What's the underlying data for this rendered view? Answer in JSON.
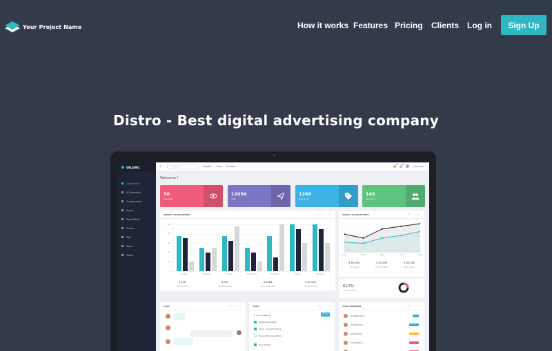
{
  "nav": {
    "brand": "Your Project Name",
    "links": [
      "How it works",
      "Features",
      "Pricing",
      "Clients",
      "Log in"
    ],
    "signup": "Sign Up"
  },
  "hero": {
    "title": "Distro - Best digital advertising company"
  },
  "dashboard": {
    "brand": "VELONIC",
    "sidebar": [
      "Dashboard",
      "UI Elements",
      "Components",
      "Forms",
      "Data Tables",
      "Charts",
      "Mail",
      "Maps",
      "Pages"
    ],
    "topbar": {
      "search": "Search...",
      "links": [
        "English",
        "Files",
        "Finished"
      ],
      "user": "John Doe"
    },
    "welcome": "Welcome !",
    "stats": [
      {
        "value": "50",
        "label": "Total Sales",
        "color": "#ef5b7b",
        "icon": "eye-icon"
      },
      {
        "value": "12056",
        "label": "Visits",
        "color": "#7b76c4",
        "icon": "send-icon"
      },
      {
        "value": "1268",
        "label": "New Orders",
        "color": "#3bb3e6",
        "icon": "tag-icon"
      },
      {
        "value": "145",
        "label": "New Users",
        "color": "#5dc37f",
        "icon": "users-icon"
      }
    ],
    "weekly": {
      "title": "WEEKLY SALES REPORT",
      "summary": [
        {
          "value": "$ 126",
          "label": "Today's Sales"
        },
        {
          "value": "$ 967",
          "label": "This Week Sales"
        },
        {
          "value": "$ 4568",
          "label": "This Month Sales"
        },
        {
          "value": "$ 67,000",
          "label": "This Year Sales"
        }
      ]
    },
    "yearly": {
      "title": "YEARLY SALES REPORT",
      "summary": [
        {
          "value": "$ 80,456",
          "label": "Total Sales"
        },
        {
          "value": "$ 50,456",
          "label": "Monthly Sales"
        },
        {
          "value": "$ 80,456",
          "label": "Yearly Sales"
        }
      ]
    },
    "conversion": {
      "value": "61.5%",
      "label": "US Dollar Share"
    },
    "chat": {
      "title": "CHAT"
    },
    "todo": {
      "title": "TODO",
      "remaining": "2 of 6 remaining",
      "button": "Archive",
      "items": [
        "Design Application",
        "Inbox - Contact fix Bug",
        "Design New page Home",
        "Fine Updates"
      ]
    },
    "team": {
      "title": "TEAM MEMBERS",
      "members": [
        {
          "name": "Jonathan Doe",
          "tag_color": "#2fb8c3"
        },
        {
          "name": "Sarah Fonia",
          "tag_color": "#2fb8c3"
        },
        {
          "name": "James Reid",
          "tag_color": "#ffc24d"
        },
        {
          "name": "Tina Watson",
          "tag_color": "#ef5b7b"
        },
        {
          "name": "Emma Wilson",
          "tag_color": "#ef5b7b"
        }
      ]
    }
  },
  "chart_data": [
    {
      "type": "bar",
      "title": "WEEKLY SALES REPORT",
      "categories": [
        "Sunday",
        "Monday",
        "Tuesday",
        "Wednesday",
        "Thursday",
        "Friday",
        "Saturday"
      ],
      "series": [
        {
          "values": [
            75,
            50,
            75,
            50,
            75,
            100,
            100
          ],
          "color": "#2fb8c3"
        },
        {
          "values": [
            70,
            40,
            65,
            40,
            30,
            90,
            90
          ],
          "color": "#1f2536"
        },
        {
          "values": [
            20,
            50,
            95,
            20,
            100,
            60,
            60
          ],
          "color": "#d6d7da"
        }
      ],
      "ylim": [
        0,
        100
      ],
      "yticks": [
        0,
        20,
        40,
        60,
        80,
        100
      ]
    },
    {
      "type": "line",
      "title": "YEARLY SALES REPORT",
      "x": [
        "2011",
        "2012",
        "2013",
        "2014",
        "2015"
      ],
      "series": [
        {
          "values": [
            60,
            45,
            80,
            90,
            100
          ],
          "color": "#1f2536"
        },
        {
          "values": [
            30,
            25,
            45,
            55,
            70
          ],
          "color": "#2fb8c3"
        }
      ],
      "ylim": [
        0,
        100
      ]
    }
  ]
}
